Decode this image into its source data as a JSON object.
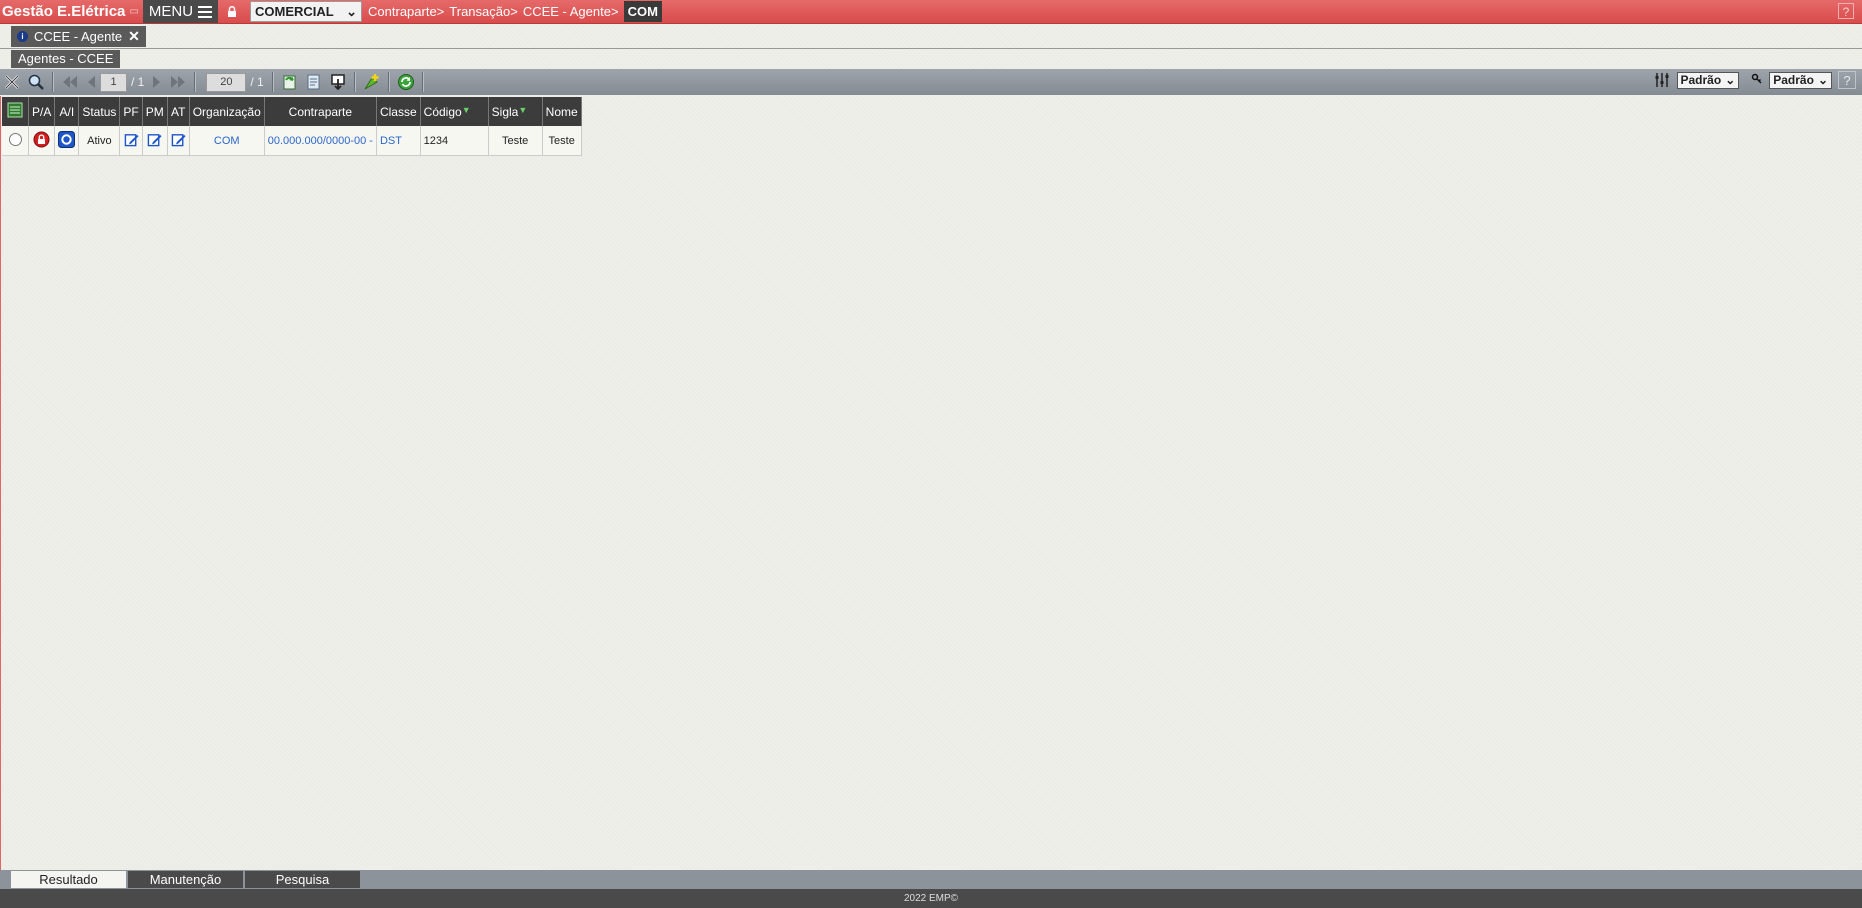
{
  "app": {
    "title": "Gestão E.Elétrica",
    "menu_label": "MENU"
  },
  "module": {
    "selected": "COMERCIAL"
  },
  "breadcrumb": [
    {
      "label": "Contraparte>"
    },
    {
      "label": "Transação>"
    },
    {
      "label": "CCEE - Agente>"
    }
  ],
  "breadcrumb_current": "COM",
  "help_label": "?",
  "window_tab": {
    "label": "CCEE - Agente",
    "close": "✕",
    "info": "i"
  },
  "sub_tab": {
    "label": "Agentes - CCEE"
  },
  "toolbar": {
    "page_current": "1",
    "page_total": "/ 1",
    "rows_per_page": "20",
    "rows_total": "/ 1",
    "layout_select": "Padrão",
    "filter_select": "Padrão"
  },
  "grid": {
    "columns": [
      "P/A",
      "A/I",
      "Status",
      "PF",
      "PM",
      "AT",
      "Organização",
      "Contraparte",
      "Classe",
      "Código",
      "Sigla",
      "Nome"
    ],
    "rows": [
      {
        "status": "Ativo",
        "organizacao": "COM",
        "contraparte": "00.000.000/0000-00 -",
        "classe": "DST",
        "codigo": "1234",
        "sigla": "Teste",
        "nome": "Teste"
      }
    ]
  },
  "bottom_tabs": [
    {
      "label": "Resultado"
    },
    {
      "label": "Manutenção"
    },
    {
      "label": "Pesquisa"
    }
  ],
  "footer": {
    "text": "2022 EMP©"
  },
  "colors": {
    "topbar": "#d94b4b",
    "header": "#3c3c3c",
    "toolbar": "#8c939a",
    "link": "#2a66c9"
  }
}
